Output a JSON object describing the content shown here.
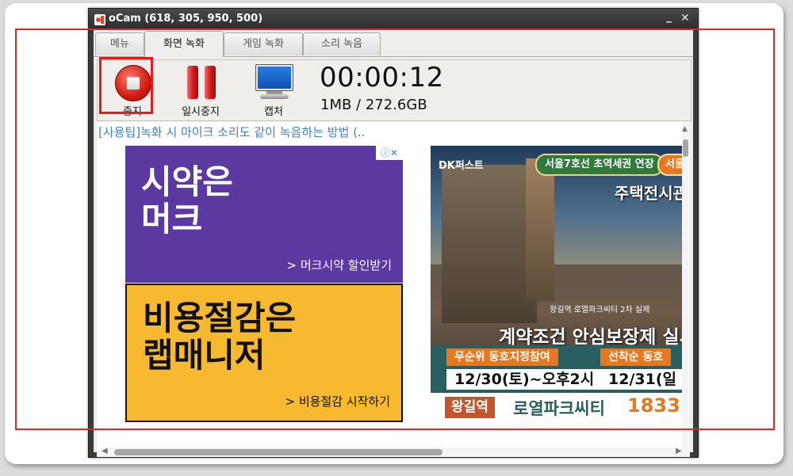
{
  "window": {
    "title": "oCam (618, 305, 950, 500)",
    "minimize_glyph": "_",
    "close_glyph": "✕"
  },
  "tabs": [
    {
      "label": "메뉴",
      "active": false
    },
    {
      "label": "화면 녹화",
      "active": true
    },
    {
      "label": "게임 녹화",
      "active": false
    },
    {
      "label": "소리 녹음",
      "active": false
    }
  ],
  "toolbar": {
    "stop_label": "중지",
    "pause_label": "일시중지",
    "capture_label": "캡처",
    "timer": "00:00:12",
    "size_info": "1MB / 272.6GB"
  },
  "content": {
    "tip_link": "[사용팁]녹화 시 마이크 소리도 같이 녹음하는 방법 (..",
    "ad_left": {
      "top_headline": "시약은\n머크",
      "top_cta": "> 머크시약 할인받기",
      "bottom_headline": "비용절감은\n랩매니저",
      "bottom_cta": "> 비용절감 시작하기",
      "choice_glyph": "ⓘ✕"
    },
    "ad_right": {
      "logo": "DK퍼스트",
      "badge": "서울7호선 초역세권 연장",
      "badge2": "서울",
      "heading": "주택전시관",
      "caption": "왕길역 로열파크씨티 2차 실제",
      "guarantee": "계약조건 안심보장제 실시",
      "pill1": "무순위 동호지정참여",
      "pill2": "선착순 동호",
      "date1": "12/30(토)~오후2시",
      "date2": "12/31(일",
      "station": "왕길역",
      "name": "로열파크씨티",
      "phone": "1833"
    }
  },
  "colors": {
    "highlight": "#e21b1b",
    "outline": "#d42b2b",
    "link": "#3f82c7"
  }
}
